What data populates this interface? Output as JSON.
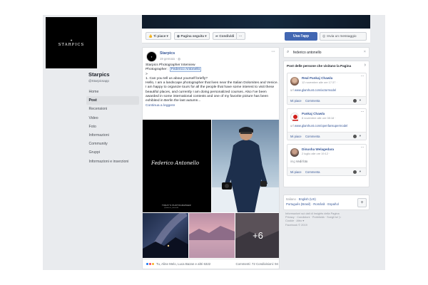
{
  "colors": {
    "brand": "#4267b2",
    "link": "#385898",
    "background": "#e9ebee"
  },
  "page": {
    "logo_text": "STARPICS",
    "name": "Starpics",
    "handle": "@Starpicsapp"
  },
  "nav": {
    "items": [
      {
        "label": "Home"
      },
      {
        "label": "Post"
      },
      {
        "label": "Recensioni"
      },
      {
        "label": "Video"
      },
      {
        "label": "Foto"
      },
      {
        "label": "Informazioni"
      },
      {
        "label": "Community"
      },
      {
        "label": "Gruppi"
      },
      {
        "label": "Informazioni e inserzioni"
      }
    ]
  },
  "actions": {
    "like": "Ti piace",
    "follow": "Pagina seguita",
    "share": "Condividi",
    "more": "···",
    "use_app": "Usa l'app",
    "message": "Invia un messaggio",
    "icons": {
      "like": "thumbs-up-icon",
      "follow": "rss-icon",
      "share": "share-icon",
      "message": "messenger-icon"
    }
  },
  "post": {
    "author": "Starpics",
    "date": "19 gennaio ·",
    "dots": "···",
    "line1": "Starpics Photographer Interview",
    "line2_prefix": "Photographer :",
    "line2_tag": "Federico Antonello",
    "line3": ">",
    "body": "1. Can you tell us about yourself briefly?\nHello, I am a landscape photographer that lives near the Italian Dolomites and Venice. I am happy to organize tours for all the people that have some interest to visit these beautiful places, and currently I am doing personalized courses. Also I've been awarded in some international contests and one of my favorite picture has been exhibited in Berlin the last autumn...",
    "read_more": "Continua a leggere",
    "photo_signature": "Federico Antonello",
    "photo_caption": "TODAY'S PHOTOGRAPHER",
    "photo_subcaption": "@federico_antonello",
    "more_photos": "+6",
    "reactions_text": "Tu, Aline Melo, Luca Bazan e altri 6322",
    "counts_text": "Commenti: 72  Condivisioni: 94"
  },
  "search": {
    "icon": "search-icon",
    "value": "federico antonello",
    "clear": "×"
  },
  "visited": {
    "heading": "Post delle persone che visitano la Pagina",
    "arrow": "›",
    "cards": [
      {
        "name": "Real Pankaj Chawla",
        "date": "12 novembre alle ore 17:37 ·",
        "link": "www.glamhunt.com/actormodel",
        "link_prefix": "url",
        "like": "Mi piace",
        "comment": "Commenta",
        "caret": "▾"
      },
      {
        "name": "Pankaj Chawla",
        "date": "8 novembre alle ore 08:18 ·",
        "link": "www.glamhunt.com/openfansupermodel",
        "link_prefix": "url",
        "like": "Mi piace",
        "comment": "Commenta",
        "caret": "▾"
      },
      {
        "name": "Dinusha Welagedara",
        "date": "2 luglio alle ore 19:12 ·",
        "link": "Vedi foto",
        "link_prefix": "img",
        "like": "Mi piace",
        "comment": "Commenta",
        "caret": "▾"
      }
    ]
  },
  "languages": {
    "line1_prefix": "Italiano ·",
    "line1_link": "English (US)",
    "line2": "Português (Brasil) · Română · Español",
    "add": "+"
  },
  "footer": {
    "line1": "Informazioni sui dati di Insights della Pagina",
    "line2": "Privacy · Condizioni · Pubblicità · Scegli tu! ▷",
    "line3": "Cookie · Altro ▾",
    "line4": "Facebook © 2019"
  }
}
